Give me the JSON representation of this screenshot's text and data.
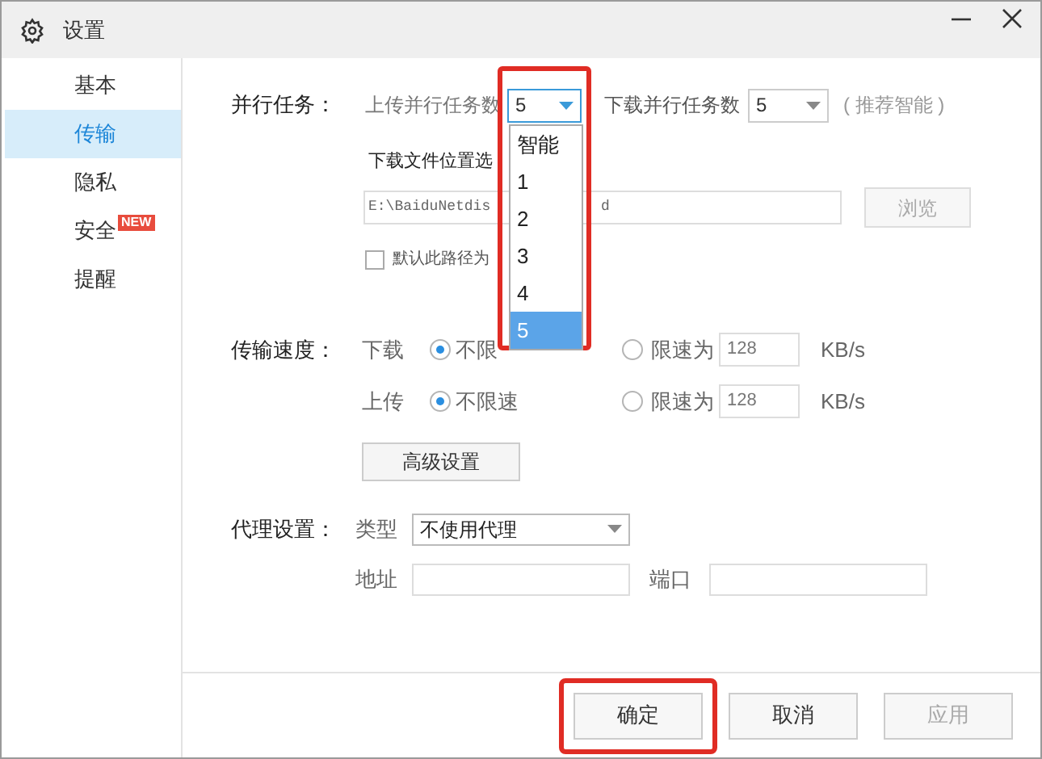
{
  "window": {
    "title": "设置"
  },
  "sidebar": {
    "items": [
      {
        "label": "基本",
        "selected": false
      },
      {
        "label": "传输",
        "selected": true
      },
      {
        "label": "隐私",
        "selected": false
      },
      {
        "label": "安全",
        "selected": false,
        "badge": "NEW"
      },
      {
        "label": "提醒",
        "selected": false
      }
    ]
  },
  "parallel": {
    "label": "并行任务：",
    "upload_label": "上传并行任务数",
    "upload_value": "5",
    "download_label": "下载并行任务数",
    "download_value": "5",
    "hint": "( 推荐智能 )",
    "dropdown_options": [
      {
        "label": "智能",
        "selected": false
      },
      {
        "label": "1",
        "selected": false
      },
      {
        "label": "2",
        "selected": false
      },
      {
        "label": "3",
        "selected": false
      },
      {
        "label": "4",
        "selected": false
      },
      {
        "label": "5",
        "selected": true
      }
    ]
  },
  "download_location": {
    "label": "下载文件位置选",
    "path_before": "E:\\BaiduNetdis",
    "path_after": "d",
    "browse_button": "浏览",
    "default_checkbox": {
      "label": "默认此路径为",
      "checked": false
    }
  },
  "speed": {
    "label": "传输速度：",
    "rows": [
      {
        "label": "下载",
        "unlimited_label": "不限",
        "unlimited_selected": true,
        "limit_label": "限速为",
        "limit_selected": false,
        "limit_value": "128",
        "unit": "KB/s"
      },
      {
        "label": "上传",
        "unlimited_label": "不限速",
        "unlimited_selected": true,
        "limit_label": "限速为",
        "limit_selected": false,
        "limit_value": "128",
        "unit": "KB/s"
      }
    ],
    "advanced_button": "高级设置"
  },
  "proxy": {
    "label": "代理设置：",
    "type_label": "类型",
    "type_value": "不使用代理",
    "address_label": "地址",
    "port_label": "端口"
  },
  "buttons": [
    {
      "label": "确定",
      "disabled": false,
      "highlighted": true
    },
    {
      "label": "取消",
      "disabled": false,
      "highlighted": false
    },
    {
      "label": "应用",
      "disabled": true,
      "highlighted": false
    }
  ]
}
